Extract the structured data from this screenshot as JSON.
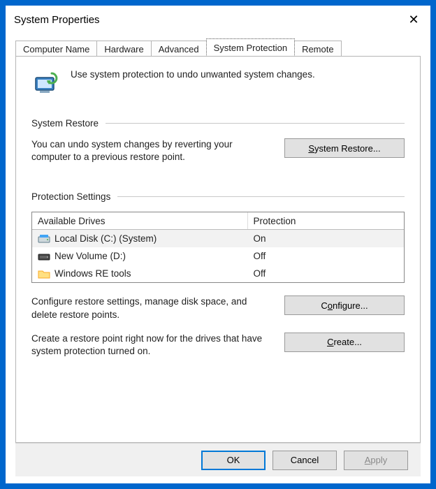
{
  "window": {
    "title": "System Properties"
  },
  "tabs": {
    "computer_name": "Computer Name",
    "hardware": "Hardware",
    "advanced": "Advanced",
    "system_protection": "System Protection",
    "remote": "Remote"
  },
  "intro": {
    "text": "Use system protection to undo unwanted system changes."
  },
  "restore": {
    "group_label": "System Restore",
    "text": "You can undo system changes by reverting your computer to a previous restore point.",
    "button_prefix": "S",
    "button_rest": "ystem Restore..."
  },
  "protection": {
    "group_label": "Protection Settings",
    "col_drives": "Available Drives",
    "col_protection": "Protection",
    "rows": [
      {
        "name": "Local Disk (C:) (System)",
        "status": "On"
      },
      {
        "name": "New Volume (D:)",
        "status": "Off"
      },
      {
        "name": "Windows RE tools",
        "status": "Off"
      }
    ],
    "configure_text": "Configure restore settings, manage disk space, and delete restore points.",
    "configure_btn_prefix": "C",
    "configure_btn_underline": "o",
    "configure_btn_rest": "nfigure...",
    "create_text": "Create a restore point right now for the drives that have system protection turned on.",
    "create_btn_underline": "C",
    "create_btn_rest": "reate..."
  },
  "footer": {
    "ok": "OK",
    "cancel": "Cancel",
    "apply_underline": "A",
    "apply_rest": "pply"
  }
}
